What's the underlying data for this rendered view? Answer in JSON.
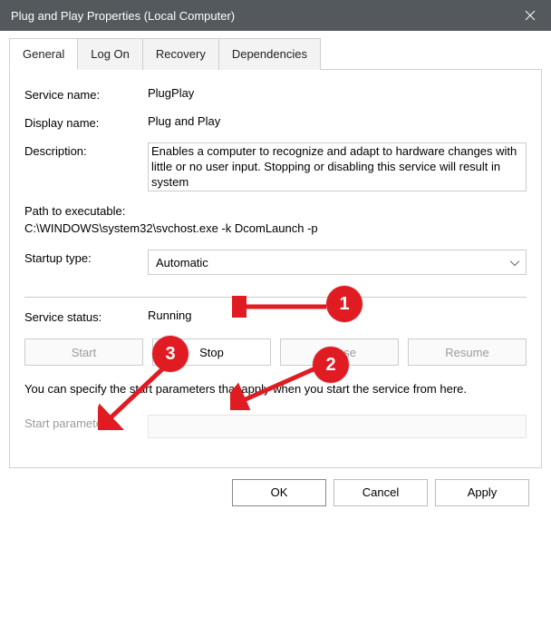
{
  "window": {
    "title": "Plug and Play Properties (Local Computer)"
  },
  "tabs": {
    "general": "General",
    "logon": "Log On",
    "recovery": "Recovery",
    "dependencies": "Dependencies"
  },
  "fields": {
    "service_name_label": "Service name:",
    "service_name_value": "PlugPlay",
    "display_name_label": "Display name:",
    "display_name_value": "Plug and Play",
    "description_label": "Description:",
    "description_value": "Enables a computer to recognize and adapt to hardware changes with little or no user input. Stopping or disabling this service will result in system",
    "path_label": "Path to executable:",
    "path_value": "C:\\WINDOWS\\system32\\svchost.exe -k DcomLaunch -p",
    "startup_type_label": "Startup type:",
    "startup_type_value": "Automatic",
    "service_status_label": "Service status:",
    "service_status_value": "Running",
    "hint": "You can specify the start parameters that apply when you start the service from here.",
    "start_params_label": "Start parameters:",
    "start_params_value": ""
  },
  "buttons": {
    "start": "Start",
    "stop": "Stop",
    "pause": "Pause",
    "resume": "Resume",
    "ok": "OK",
    "cancel": "Cancel",
    "apply": "Apply"
  },
  "annotations": {
    "b1": "1",
    "b2": "2",
    "b3": "3"
  }
}
